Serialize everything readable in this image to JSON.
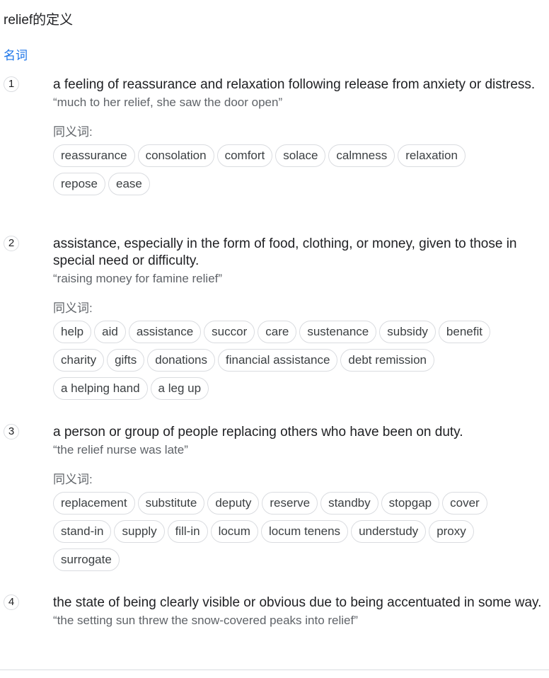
{
  "title": "relief的定义",
  "part_of_speech": "名词",
  "synonyms_label": "同义词:",
  "senses": [
    {
      "number": "1",
      "definition": "a feeling of reassurance and relaxation following release from anxiety or distress.",
      "example": "“much to her relief, she saw the door open”",
      "synonyms": [
        [
          "reassurance",
          "consolation",
          "comfort",
          "solace",
          "calmness",
          "relaxation"
        ],
        [
          "repose",
          "ease"
        ]
      ]
    },
    {
      "number": "2",
      "definition": "assistance, especially in the form of food, clothing, or money, given to those in special need or difficulty.",
      "example": "“raising money for famine relief”",
      "synonyms": [
        [
          "help",
          "aid",
          "assistance",
          "succor",
          "care",
          "sustenance",
          "subsidy",
          "benefit"
        ],
        [
          "charity",
          "gifts",
          "donations",
          "financial assistance",
          "debt remission"
        ],
        [
          "a helping hand",
          "a leg up"
        ]
      ]
    },
    {
      "number": "3",
      "definition": "a person or group of people replacing others who have been on duty.",
      "example": "“the relief nurse was late”",
      "synonyms": [
        [
          "replacement",
          "substitute",
          "deputy",
          "reserve",
          "standby",
          "stopgap",
          "cover"
        ],
        [
          "stand-in",
          "supply",
          "fill-in",
          "locum",
          "locum tenens",
          "understudy",
          "proxy"
        ],
        [
          "surrogate"
        ]
      ]
    },
    {
      "number": "4",
      "definition": "the state of being clearly visible or obvious due to being accentuated in some way.",
      "example": "“the setting sun threw the snow-covered peaks into relief”",
      "synonyms": []
    }
  ]
}
